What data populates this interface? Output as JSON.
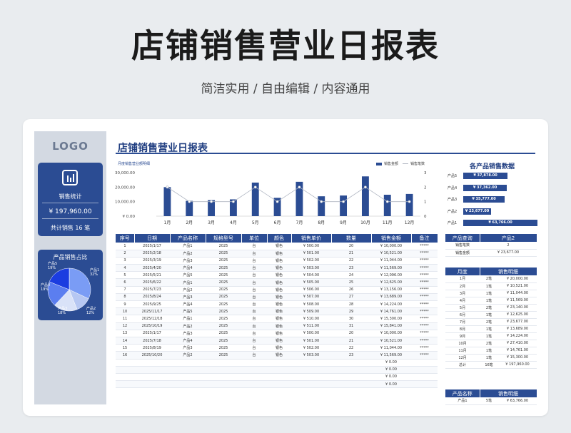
{
  "hero": {
    "title": "店铺销售营业日报表",
    "subtitle": "简洁实用 / 自由编辑 / 内容通用"
  },
  "sidebar": {
    "logo": "LOGO",
    "stat": {
      "label": "销售统计",
      "value": "¥ 197,960.00",
      "count_prefix": "共计销售",
      "count": "16",
      "count_suffix": "笔"
    },
    "pie": {
      "title": "产品销售占比",
      "slices": [
        {
          "name": "产品1",
          "pct": 32,
          "label": "32%",
          "color": "#7a9cf5"
        },
        {
          "name": "产品2",
          "pct": 12,
          "label": "12%",
          "color": "#b6c7f2"
        },
        {
          "name": "产品3",
          "pct": 18,
          "label": "18%",
          "color": "#d9e2f8"
        },
        {
          "name": "产品4",
          "pct": 19,
          "label": "19%",
          "color": "#5b7ef0"
        },
        {
          "name": "产品5",
          "pct": 19,
          "label": "19%",
          "color": "#1b3de0"
        }
      ]
    }
  },
  "report": {
    "title": "店铺销售营业日报表",
    "chart_caption": "月度销售营业额明细"
  },
  "chart_data": {
    "type": "bar",
    "categories": [
      "1月",
      "2月",
      "3月",
      "4月",
      "5月",
      "6月",
      "7月",
      "8月",
      "9月",
      "10月",
      "11月",
      "12月"
    ],
    "series": [
      {
        "name": "销售金额",
        "type": "bar",
        "values": [
          20000,
          10521,
          11044,
          11569,
          23140,
          12625,
          23677,
          13689,
          14224,
          27410,
          14761,
          15300
        ]
      },
      {
        "name": "销售笔数",
        "type": "line",
        "values": [
          2,
          1,
          1,
          1,
          2,
          1,
          2,
          1,
          1,
          2,
          1,
          1
        ]
      }
    ],
    "y_ticks": [
      "¥ 0.00",
      "¥ 10,000.00",
      "¥ 20,000.00",
      "¥ 30,000.00"
    ],
    "y2_ticks": [
      "0",
      "1",
      "2",
      "3"
    ],
    "ylim": [
      0,
      30000
    ],
    "y2lim": [
      0,
      3
    ],
    "legend": [
      "销售金额",
      "销售笔数"
    ],
    "colors": {
      "bar": "#2b4c93",
      "line": "#b0b6c2"
    }
  },
  "table": {
    "headers": [
      "序号",
      "日期",
      "产品名称",
      "规格型号",
      "单位",
      "颜色",
      "销售单价",
      "数量",
      "销售金额",
      "备注"
    ],
    "rows": [
      [
        "1",
        "2025/1/17",
        "产品1",
        "2025",
        "台",
        "银色",
        "¥ 500.00",
        "20",
        "¥ 10,000.00",
        "*****"
      ],
      [
        "2",
        "2025/2/18",
        "产品2",
        "2025",
        "台",
        "银色",
        "¥ 501.00",
        "21",
        "¥ 10,521.00",
        "*****"
      ],
      [
        "3",
        "2025/3/19",
        "产品3",
        "2025",
        "台",
        "银色",
        "¥ 502.00",
        "22",
        "¥ 11,044.00",
        "*****"
      ],
      [
        "4",
        "2025/4/20",
        "产品4",
        "2025",
        "台",
        "银色",
        "¥ 503.00",
        "23",
        "¥ 11,569.00",
        "*****"
      ],
      [
        "5",
        "2025/5/21",
        "产品5",
        "2025",
        "台",
        "银色",
        "¥ 504.00",
        "24",
        "¥ 12,096.00",
        "*****"
      ],
      [
        "6",
        "2025/6/22",
        "产品1",
        "2025",
        "台",
        "银色",
        "¥ 505.00",
        "25",
        "¥ 12,625.00",
        "*****"
      ],
      [
        "7",
        "2025/7/23",
        "产品2",
        "2025",
        "台",
        "银色",
        "¥ 506.00",
        "26",
        "¥ 13,156.00",
        "*****"
      ],
      [
        "8",
        "2025/8/24",
        "产品3",
        "2025",
        "台",
        "银色",
        "¥ 507.00",
        "27",
        "¥ 13,689.00",
        "*****"
      ],
      [
        "9",
        "2025/9/25",
        "产品4",
        "2025",
        "台",
        "银色",
        "¥ 508.00",
        "28",
        "¥ 14,224.00",
        "*****"
      ],
      [
        "10",
        "2025/11/17",
        "产品5",
        "2025",
        "台",
        "银色",
        "¥ 509.00",
        "29",
        "¥ 14,761.00",
        "*****"
      ],
      [
        "11",
        "2025/12/18",
        "产品1",
        "2025",
        "台",
        "银色",
        "¥ 510.00",
        "30",
        "¥ 15,300.00",
        "*****"
      ],
      [
        "12",
        "2025/10/19",
        "产品2",
        "2025",
        "台",
        "银色",
        "¥ 511.00",
        "31",
        "¥ 15,841.00",
        "*****"
      ],
      [
        "13",
        "2025/1/17",
        "产品3",
        "2025",
        "台",
        "银色",
        "¥ 500.00",
        "20",
        "¥ 10,000.00",
        "*****"
      ],
      [
        "14",
        "2025/7/18",
        "产品4",
        "2025",
        "台",
        "银色",
        "¥ 501.00",
        "21",
        "¥ 10,521.00",
        "*****"
      ],
      [
        "15",
        "2025/8/19",
        "产品3",
        "2025",
        "台",
        "银色",
        "¥ 502.00",
        "22",
        "¥ 11,044.00",
        "*****"
      ],
      [
        "16",
        "2025/10/20",
        "产品2",
        "2025",
        "台",
        "银色",
        "¥ 503.00",
        "23",
        "¥ 11,569.00",
        "*****"
      ],
      [
        "",
        "",
        "",
        "",
        "",
        "",
        "",
        "",
        "¥ 0.00",
        ""
      ],
      [
        "",
        "",
        "",
        "",
        "",
        "",
        "",
        "",
        "¥ 0.00",
        ""
      ],
      [
        "",
        "",
        "",
        "",
        "",
        "",
        "",
        "",
        "¥ 0.00",
        ""
      ],
      [
        "",
        "",
        "",
        "",
        "",
        "",
        "",
        "",
        "¥ 0.00",
        ""
      ]
    ]
  },
  "right_panel": {
    "title": "各产品销售数据",
    "bars": [
      {
        "name": "产品5",
        "value": "¥ 37,878.00",
        "amount": 37878
      },
      {
        "name": "产品4",
        "value": "¥ 37,362.00",
        "amount": 37362
      },
      {
        "name": "产品3",
        "value": "¥ 35,777.00",
        "amount": 35777
      },
      {
        "name": "产品2",
        "value": "¥ 23,677.00",
        "amount": 23677
      },
      {
        "name": "产品1",
        "value": "¥ 63,766.00",
        "amount": 63766
      }
    ],
    "query": {
      "header_left": "产品查询",
      "header_right": "产品2",
      "rows": [
        [
          "销售笔数",
          "2"
        ],
        [
          "销售金额",
          "¥ 23,677.00"
        ]
      ]
    },
    "monthly": {
      "headers": [
        "月度",
        "销售明细"
      ],
      "rows": [
        [
          "1月",
          "2笔",
          "¥ 20,000.00"
        ],
        [
          "2月",
          "1笔",
          "¥ 10,521.00"
        ],
        [
          "3月",
          "1笔",
          "¥ 11,044.00"
        ],
        [
          "4月",
          "1笔",
          "¥ 11,569.00"
        ],
        [
          "5月",
          "2笔",
          "¥ 23,140.00"
        ],
        [
          "6月",
          "1笔",
          "¥ 12,625.00"
        ],
        [
          "7月",
          "2笔",
          "¥ 23,677.00"
        ],
        [
          "8月",
          "1笔",
          "¥ 13,689.00"
        ],
        [
          "9月",
          "1笔",
          "¥ 14,224.00"
        ],
        [
          "10月",
          "2笔",
          "¥ 27,410.00"
        ],
        [
          "11月",
          "1笔",
          "¥ 14,761.00"
        ],
        [
          "12月",
          "1笔",
          "¥ 15,300.00"
        ],
        [
          "总计",
          "16笔",
          "¥ 197,960.00"
        ]
      ]
    },
    "product_detail": {
      "headers": [
        "产品名称",
        "销售明细"
      ],
      "rows": [
        [
          "产品1",
          "5笔",
          "¥ 63,766.00"
        ]
      ]
    }
  }
}
